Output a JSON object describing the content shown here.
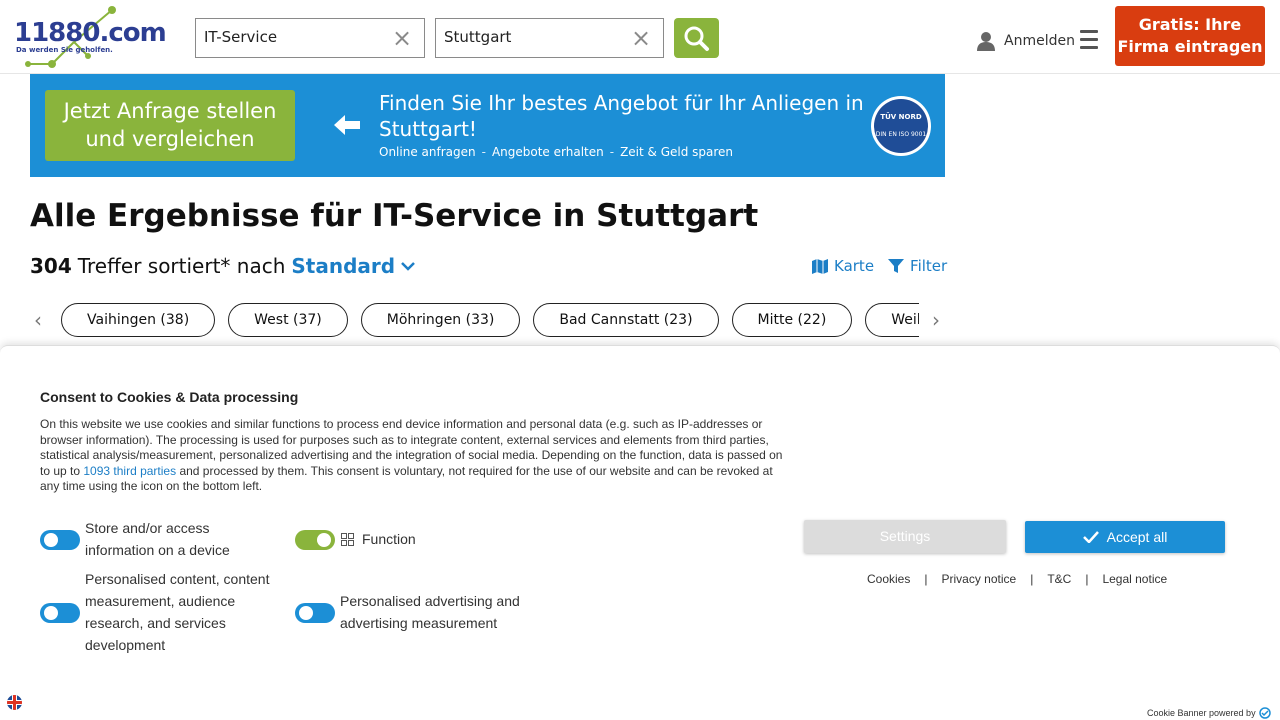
{
  "header": {
    "logo_text": "11880.com",
    "logo_tagline": "Da werden Sie geholfen.",
    "what_value": "IT-Service",
    "where_value": "Stuttgart",
    "login_label": "Anmelden",
    "cta_line1": "Gratis: Ihre",
    "cta_line2": "Firma eintragen"
  },
  "banner": {
    "button_line1": "Jetzt Anfrage stellen",
    "button_line2": "und vergleichen",
    "title": "Finden Sie Ihr bestes Angebot für Ihr Anliegen in Stuttgart!",
    "steps": [
      "Online anfragen",
      "Angebote erhalten",
      "Zeit & Geld sparen"
    ],
    "separator": "-",
    "badge_line1": "TÜV NORD",
    "badge_line2": "DIN EN ISO 9001"
  },
  "results": {
    "title": "Alle Ergebnisse für IT-Service in Stuttgart",
    "count": "304",
    "sorted_text": "Treffer sortiert* nach",
    "sort_value": "Standard",
    "map_label": "Karte",
    "filter_label": "Filter",
    "chips": [
      "Vaihingen (38)",
      "West (37)",
      "Möhringen (33)",
      "Bad Cannstatt (23)",
      "Mitte (22)",
      "Weilimdorf"
    ]
  },
  "consent": {
    "title": "Consent to Cookies & Data processing",
    "text_before_link": "On this website we use cookies and similar functions to process end device information and personal data (e.g. such as IP-addresses or browser information). The processing is used for purposes such as to integrate content, external services and elements from third parties, statistical analysis/measurement, personalized advertising and the integration of social media. Depending on the function, data is passed on to up to ",
    "link_text": "1093 third parties",
    "text_after_link": " and processed by them. This consent is voluntary, not required for the use of our website and can be revoked at any time using the icon on the bottom left.",
    "toggles": {
      "store": "Store and/or access information on a device",
      "function": "Function",
      "personalised_content": "Personalised content, content measurement, audience research, and services development",
      "personalised_ads": "Personalised advertising and advertising measurement"
    },
    "settings_label": "Settings",
    "accept_label": "Accept all",
    "links": [
      "Cookies",
      "Privacy notice",
      "T&C",
      "Legal notice"
    ],
    "link_separator": "|",
    "powered_by": "Cookie Banner powered by"
  },
  "colors": {
    "brand_green": "#8ab43c",
    "brand_blue": "#1c8fd6",
    "cta_red": "#d93d10",
    "link_blue": "#1c7ec6"
  }
}
